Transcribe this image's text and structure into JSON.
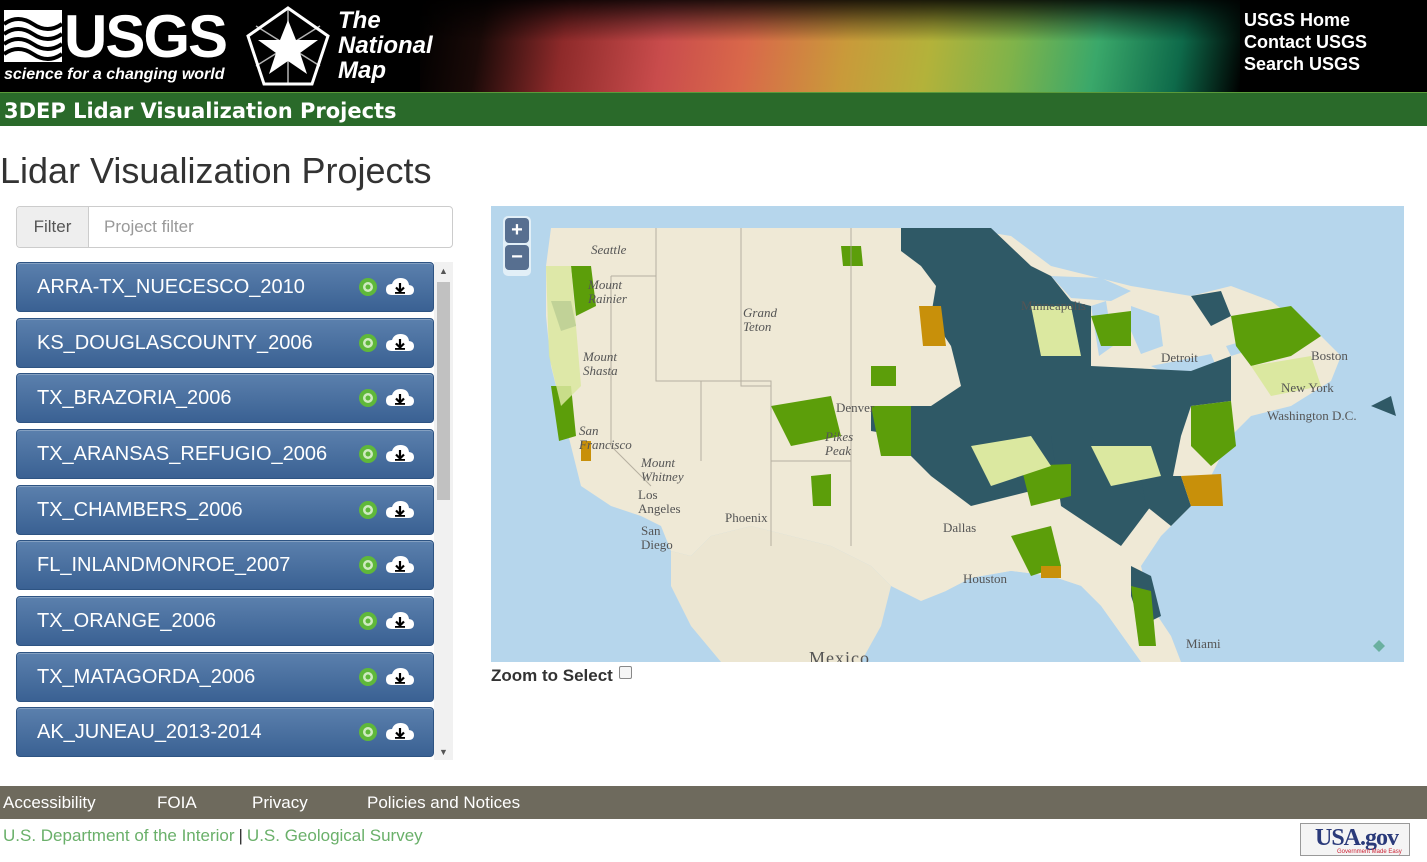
{
  "header": {
    "usgs_word": "USGS",
    "usgs_tagline": "science for a changing world",
    "tnm_line1": "The",
    "tnm_line2": "National",
    "tnm_line3": "Map",
    "links": [
      "USGS Home",
      "Contact USGS",
      "Search USGS"
    ]
  },
  "app_title": "3DEP Lidar Visualization Projects",
  "page_title": "Lidar Visualization Projects",
  "filter": {
    "label": "Filter",
    "placeholder": "Project filter",
    "value": ""
  },
  "projects": [
    "ARRA-TX_NUECESCO_2010",
    "KS_DOUGLASCOUNTY_2006",
    "TX_BRAZORIA_2006",
    "TX_ARANSAS_REFUGIO_2006",
    "TX_CHAMBERS_2006",
    "FL_INLANDMONROE_2007",
    "TX_ORANGE_2006",
    "TX_MATAGORDA_2006",
    "AK_JUNEAU_2013-2014"
  ],
  "map": {
    "zoom_in": "+",
    "zoom_out": "−",
    "labels": [
      "Seattle",
      "Mount Rainier",
      "Minneapolis",
      "Grand Teton",
      "Detroit",
      "Boston",
      "New York",
      "Mount Shasta",
      "Denver",
      "Washington D.C.",
      "San Francisco",
      "Pikes Peak",
      "Mount Whitney",
      "Los Angeles",
      "Phoenix",
      "Dallas",
      "San Diego",
      "Houston",
      "Miami",
      "Mexico"
    ],
    "colors": {
      "water": "#b6d6ec",
      "land": "#efe9d6",
      "coverage_dark": "#2f5966",
      "coverage_green": "#5c9e0a",
      "coverage_light": "#dbe8a0",
      "coverage_orange": "#c8900a"
    }
  },
  "zoom_to_select": {
    "label": "Zoom to Select",
    "checked": false
  },
  "footer": {
    "links": [
      "Accessibility",
      "FOIA",
      "Privacy",
      "Policies and Notices"
    ],
    "doi": "U.S. Department of the Interior",
    "separator": "|",
    "usgs": "U.S. Geological Survey",
    "usagov": "USA.gov",
    "usagov_small": "Government Made Easy"
  }
}
